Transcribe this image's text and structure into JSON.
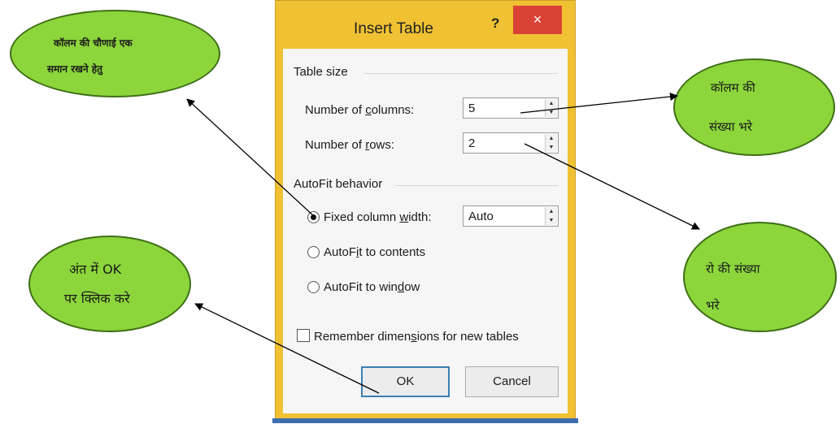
{
  "dialog": {
    "title": "Insert Table",
    "help_glyph": "?",
    "close_glyph": "×",
    "table_size_label": "Table size",
    "columns_label_pre": "Number of ",
    "columns_label_key": "c",
    "columns_label_post": "olumns:",
    "columns_value": "5",
    "rows_label_pre": "Number of ",
    "rows_label_key": "r",
    "rows_label_post": "ows:",
    "rows_value": "2",
    "autofit_label": "AutoFit behavior",
    "fixed_pre": "Fixed column ",
    "fixed_key": "w",
    "fixed_post": "idth:",
    "fixed_value": "Auto",
    "contents_pre": "AutoF",
    "contents_key": "i",
    "contents_post": "t to contents",
    "window_pre": "AutoFit to win",
    "window_key": "d",
    "window_post": "ow",
    "remember_pre": "Remember dimen",
    "remember_key": "s",
    "remember_post": "ions for new tables",
    "ok_label": "OK",
    "cancel_label": "Cancel",
    "selected_option": "Fixed column width",
    "remember_checked": false
  },
  "annotations": {
    "equal_width": [
      "कॉलम की चौणाई एक",
      "समान रखने हेतु"
    ],
    "columns": [
      "कॉलम की",
      "संख्या भरे"
    ],
    "rows": [
      "रो की संख्या",
      "भरे"
    ],
    "ok": [
      "अंत में OK",
      "पर क्लिक करे"
    ]
  },
  "colors": {
    "dialog_frame": "#f0c233",
    "close_button": "#d94235",
    "bubble_fill": "#8cd63c",
    "bubble_border": "#3f6f16",
    "ok_border": "#3c7fb1"
  }
}
